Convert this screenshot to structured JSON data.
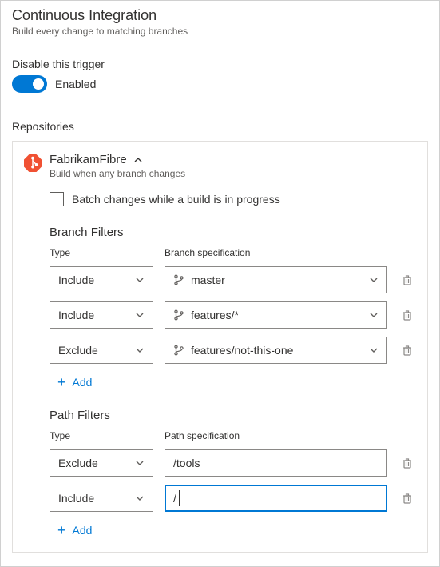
{
  "header": {
    "title": "Continuous Integration",
    "subtitle": "Build every change to matching branches"
  },
  "disable": {
    "label": "Disable this trigger",
    "state": "Enabled"
  },
  "repositories_label": "Repositories",
  "repo": {
    "name": "FabrikamFibre",
    "subtitle": "Build when any branch changes",
    "batch_label": "Batch changes while a build is in progress"
  },
  "branch_filters": {
    "title": "Branch Filters",
    "type_header": "Type",
    "spec_header": "Branch specification",
    "rows": [
      {
        "type": "Include",
        "spec": "master"
      },
      {
        "type": "Include",
        "spec": "features/*"
      },
      {
        "type": "Exclude",
        "spec": "features/not-this-one"
      }
    ],
    "add_label": "Add"
  },
  "path_filters": {
    "title": "Path Filters",
    "type_header": "Type",
    "spec_header": "Path specification",
    "rows": [
      {
        "type": "Exclude",
        "spec": "/tools",
        "active": false
      },
      {
        "type": "Include",
        "spec": "/",
        "active": true
      }
    ],
    "add_label": "Add"
  }
}
